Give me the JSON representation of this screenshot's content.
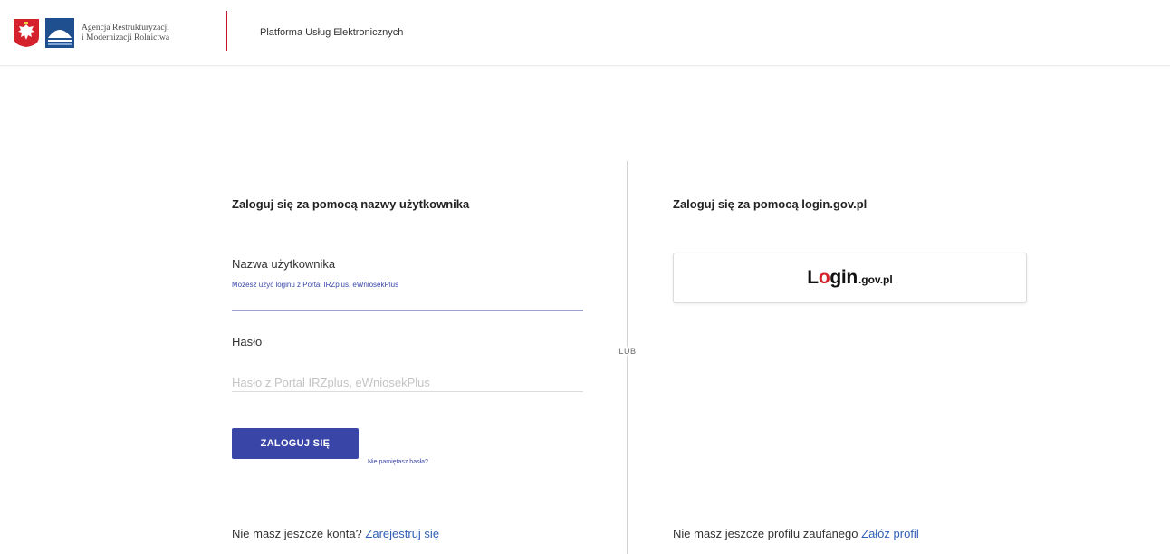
{
  "header": {
    "agency_name_line1": "Agencja Restrukturyzacji",
    "agency_name_line2": "i Modernizacji Rolnictwa",
    "platform_title": "Platforma Usług Elektronicznych",
    "icons": [
      "polish-eagle-emblem",
      "arimr-logo"
    ],
    "divider_color": "#c8142c"
  },
  "left_panel": {
    "title": "Zaloguj się za pomocą nazwy użytkownika",
    "username": {
      "label": "Nazwa użytkownika",
      "hint": "Możesz użyć loginu z Portal IRZplus, eWniosekPlus",
      "value": ""
    },
    "password": {
      "label": "Hasło",
      "placeholder": "Hasło z Portal IRZplus, eWniosekPlus",
      "value": ""
    },
    "login_button": "ZALOGUJ SIĘ",
    "forgot_password": "Nie pamiętasz hasła?",
    "register_prompt": "Nie masz jeszcze konta?",
    "register_link": "Zarejestruj się"
  },
  "separator": {
    "label": "LUB"
  },
  "right_panel": {
    "title": "Zaloguj się za pomocą login.gov.pl",
    "login_gov": {
      "big_text_a": "L",
      "big_text_o": "o",
      "big_text_b": "gin",
      "small_text": ".gov.pl"
    },
    "profile_prompt": "Nie masz jeszcze profilu zaufanego",
    "profile_link": "Załóż profil"
  },
  "colors": {
    "primary_button": "#3a45a8",
    "link": "#2f5fb5",
    "accent_red": "#d4212b"
  }
}
